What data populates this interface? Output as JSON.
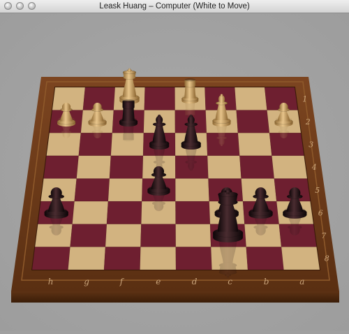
{
  "window": {
    "title": "Leask Huang – Computer   (White to Move)"
  },
  "colors": {
    "light_square": "#d2b380",
    "dark_square": "#6e1f30",
    "frame": "#6b3a18",
    "white_piece": "#c9a26a",
    "black_piece": "#221316"
  },
  "board": {
    "rank_labels": [
      "1",
      "2",
      "3",
      "4",
      "5",
      "6",
      "7",
      "8"
    ],
    "file_labels": [
      "h",
      "g",
      "f",
      "e",
      "d",
      "c",
      "b",
      "a"
    ],
    "pieces": [
      {
        "color": "white",
        "type": "king",
        "square": "f1",
        "icon": "white-king-icon"
      },
      {
        "color": "white",
        "type": "rook",
        "square": "d1",
        "icon": "white-rook-icon"
      },
      {
        "color": "white",
        "type": "pawn",
        "square": "h2",
        "icon": "white-pawn-icon"
      },
      {
        "color": "white",
        "type": "pawn",
        "square": "g2",
        "icon": "white-pawn-icon"
      },
      {
        "color": "white",
        "type": "bishop",
        "square": "c2",
        "icon": "white-bishop-icon"
      },
      {
        "color": "white",
        "type": "pawn",
        "square": "a2",
        "icon": "white-pawn-icon"
      },
      {
        "color": "black",
        "type": "rook",
        "square": "f2",
        "icon": "black-rook-icon"
      },
      {
        "color": "black",
        "type": "bishop",
        "square": "e3",
        "icon": "black-bishop-icon"
      },
      {
        "color": "black",
        "type": "bishop",
        "square": "d3",
        "icon": "black-bishop-icon"
      },
      {
        "color": "black",
        "type": "pawn",
        "square": "e5",
        "icon": "black-pawn-icon"
      },
      {
        "color": "black",
        "type": "pawn",
        "square": "h6",
        "icon": "black-pawn-icon"
      },
      {
        "color": "black",
        "type": "pawn",
        "square": "c6",
        "icon": "black-pawn-icon"
      },
      {
        "color": "black",
        "type": "pawn",
        "square": "b6",
        "icon": "black-pawn-icon"
      },
      {
        "color": "black",
        "type": "pawn",
        "square": "a6",
        "icon": "black-pawn-icon"
      },
      {
        "color": "black",
        "type": "king",
        "square": "c7",
        "icon": "black-king-icon"
      }
    ]
  }
}
